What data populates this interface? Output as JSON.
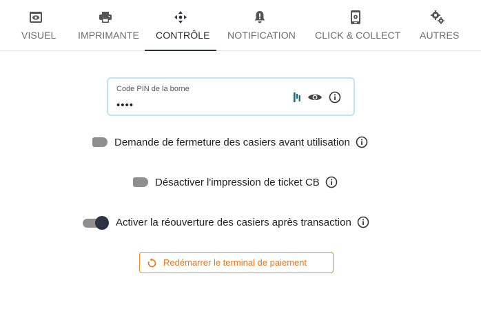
{
  "tabs": [
    {
      "label": "VISUEL",
      "icon": "monitor-eye-icon"
    },
    {
      "label": "IMPRIMANTE",
      "icon": "printer-icon"
    },
    {
      "label": "CONTRÔLE",
      "icon": "move-arrows-icon",
      "active": true
    },
    {
      "label": "NOTIFICATION",
      "icon": "bell-alert-icon"
    },
    {
      "label": "CLICK & COLLECT",
      "icon": "phone-settings-icon"
    },
    {
      "label": "AUTRES",
      "icon": "gears-icon"
    }
  ],
  "pin": {
    "label": "Code PIN de la borne",
    "value": "••••"
  },
  "options": [
    {
      "label": "Demande de fermeture des casiers avant utilisation",
      "enabled": false
    },
    {
      "label": "Désactiver l'impression de ticket CB",
      "enabled": false
    },
    {
      "label": "Activer la réouverture des casiers après transaction",
      "enabled": true
    }
  ],
  "restart_button": {
    "label": "Redémarrer le terminal de paiement"
  },
  "colors": {
    "accent_dark": "#2c3345",
    "orange": "#e9751a",
    "field_border": "#bfe4f2",
    "teal_icon": "#1d6b7a"
  }
}
